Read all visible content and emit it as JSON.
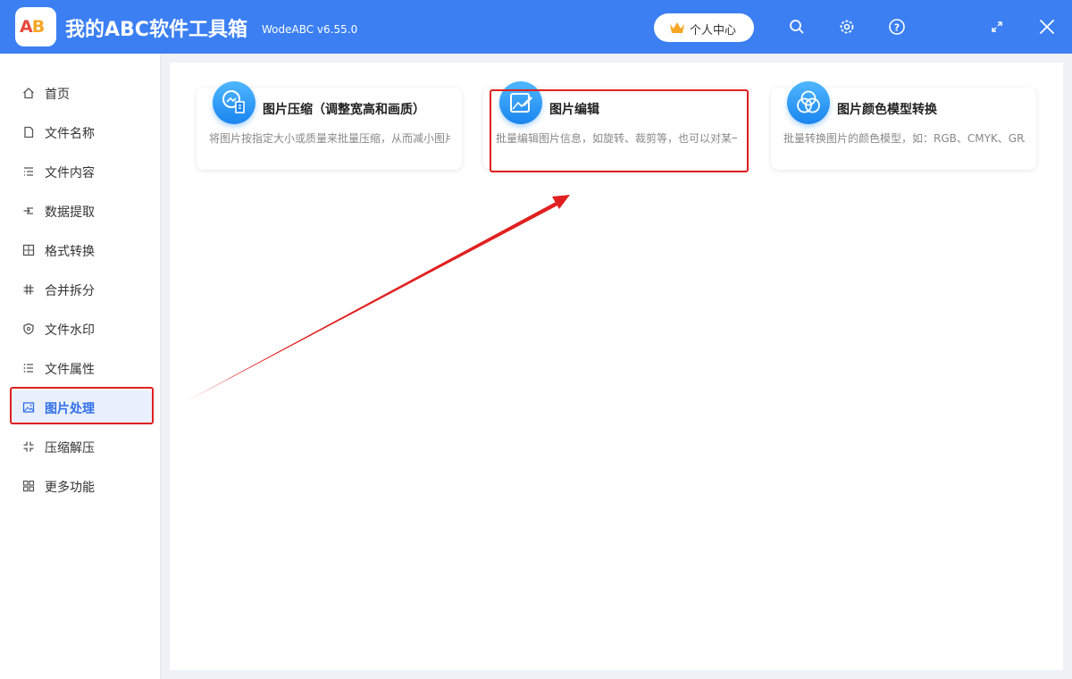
{
  "app": {
    "logo_text_a": "A",
    "logo_text_b": "B",
    "title": "我的ABC软件工具箱",
    "version": "WodeABC v6.55.0",
    "user_center": "个人中心"
  },
  "titlebar_icons": [
    "search-icon",
    "gear-icon",
    "help-icon",
    "maximize-icon",
    "close-icon"
  ],
  "sidebar": {
    "items": [
      {
        "label": "首页",
        "icon": "home-icon"
      },
      {
        "label": "文件名称",
        "icon": "file-name-icon"
      },
      {
        "label": "文件内容",
        "icon": "file-content-icon"
      },
      {
        "label": "数据提取",
        "icon": "data-extract-icon"
      },
      {
        "label": "格式转换",
        "icon": "format-convert-icon"
      },
      {
        "label": "合并拆分",
        "icon": "merge-split-icon"
      },
      {
        "label": "文件水印",
        "icon": "watermark-icon"
      },
      {
        "label": "文件属性",
        "icon": "file-attr-icon"
      },
      {
        "label": "图片处理",
        "icon": "image-icon",
        "active": true
      },
      {
        "label": "压缩解压",
        "icon": "compress-icon"
      },
      {
        "label": "更多功能",
        "icon": "more-icon"
      }
    ]
  },
  "cards": [
    {
      "title": "图片压缩（调整宽高和画质）",
      "desc": "将图片按指定大小或质量来批量压缩，从而减小图片"
    },
    {
      "title": "图片编辑",
      "desc": "批量编辑图片信息，如旋转、裁剪等，也可以对某一"
    },
    {
      "title": "图片颜色模型转换",
      "desc": "批量转换图片的颜色模型，如：RGB、CMYK、GRA"
    }
  ],
  "colors": {
    "titlebar": "#3b7ff3",
    "accent": "#3170e8",
    "highlight_red": "#e02020"
  }
}
